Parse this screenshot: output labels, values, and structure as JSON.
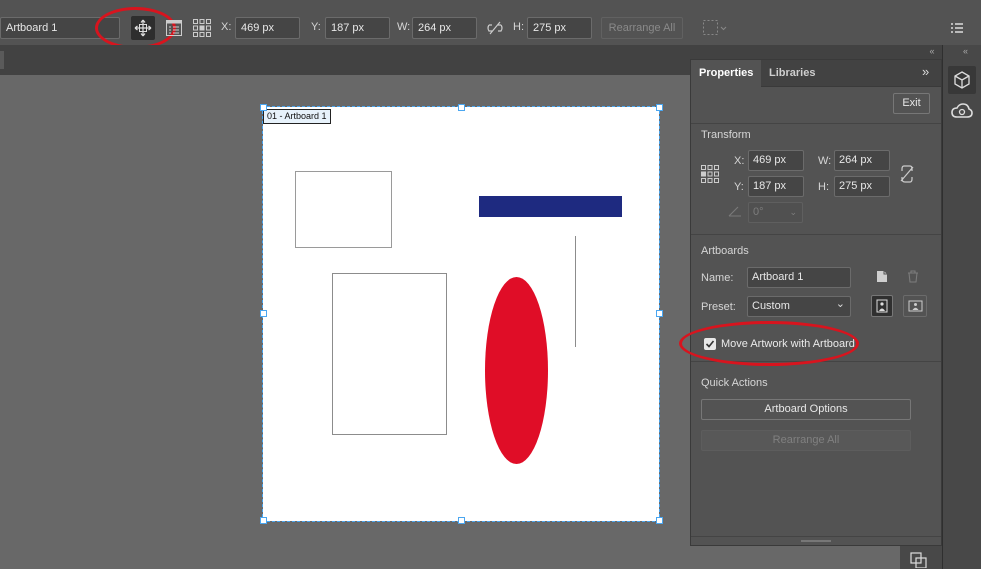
{
  "toolbar": {
    "artboard_name": "Artboard 1",
    "x_label": "X:",
    "x_value": "469 px",
    "y_label": "Y:",
    "y_value": "187 px",
    "w_label": "W:",
    "w_value": "264 px",
    "h_label": "H:",
    "h_value": "275 px",
    "rearrange_label": "Rearrange All"
  },
  "artboard": {
    "label": "01 - Artboard 1"
  },
  "shapes": {
    "blue_bar_color": "#1e2a80",
    "ellipse_color": "#e00d27"
  },
  "panel": {
    "tabs": [
      "Properties",
      "Libraries"
    ],
    "exit_label": "Exit",
    "transform": {
      "title": "Transform",
      "x_label": "X:",
      "x_value": "469 px",
      "y_label": "Y:",
      "y_value": "187 px",
      "w_label": "W:",
      "w_value": "264 px",
      "h_label": "H:",
      "h_value": "275 px",
      "angle_value": "0°"
    },
    "artboards": {
      "title": "Artboards",
      "name_label": "Name:",
      "name_value": "Artboard 1",
      "preset_label": "Preset:",
      "preset_value": "Custom",
      "move_artwork_label": "Move Artwork with Artboard",
      "move_artwork_checked": true
    },
    "quick_actions": {
      "title": "Quick Actions",
      "artboard_options_label": "Artboard Options",
      "rearrange_all_label": "Rearrange All"
    }
  },
  "annotation_color": "#d8141e"
}
